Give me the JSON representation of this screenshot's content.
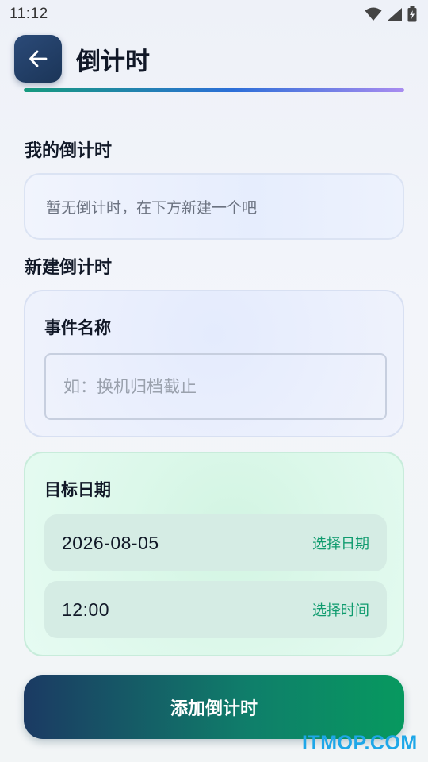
{
  "status_bar": {
    "time": "11:12"
  },
  "header": {
    "title": "倒计时"
  },
  "my_countdowns": {
    "title": "我的倒计时",
    "empty_text": "暂无倒计时，在下方新建一个吧"
  },
  "new_countdown": {
    "title": "新建倒计时",
    "event_name": {
      "label": "事件名称",
      "value": "",
      "placeholder": "如：换机归档截止"
    },
    "target_date": {
      "label": "目标日期",
      "date_value": "2026-08-05",
      "date_action": "选择日期",
      "time_value": "12:00",
      "time_action": "选择时间"
    },
    "submit_label": "添加倒计时"
  },
  "watermark": "ITMOP.COM",
  "colors": {
    "accent_green": "#0f9b6e",
    "navy": "#1b3558",
    "button_gradient_start": "#1b3a63",
    "button_gradient_end": "#07995f"
  }
}
